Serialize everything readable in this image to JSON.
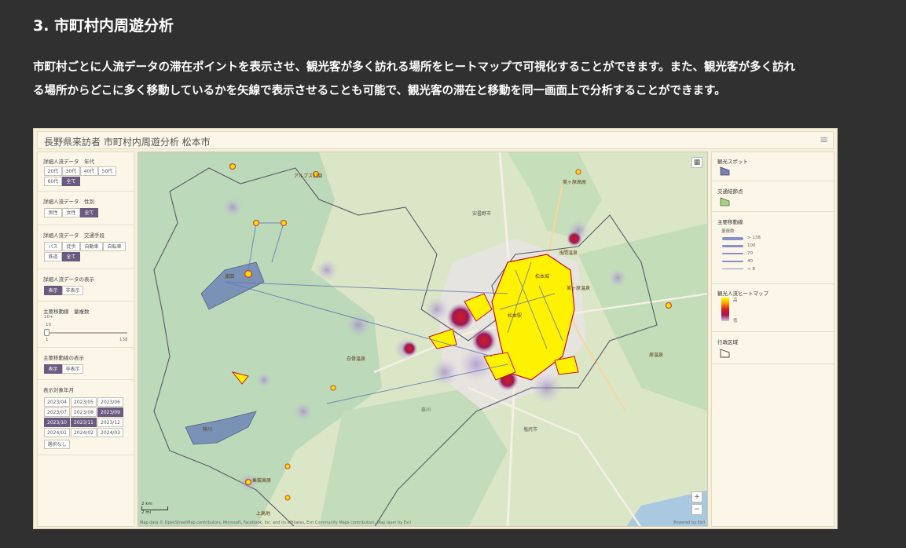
{
  "section": {
    "title": "3. 市町村内周遊分析",
    "desc_line1": "市町村ごとに人流データの滞在ポイントを表示させ、観光客が多く訪れる場所をヒートマップで可視化することができます。また、観光客が多く訪れ",
    "desc_line2": "る場所からどこに多く移動しているかを矢線で表示させることも可能で、観光客の滞在と移動を同一画面上で分析することができます。"
  },
  "app": {
    "title": "長野県来訪者 市町村内周遊分析 松本市",
    "menu_icon": "hamburger-icon"
  },
  "filters": {
    "age": {
      "label": "詳細人流データ　年代",
      "options": [
        "20代",
        "30代",
        "40代",
        "50代",
        "60代",
        "全て"
      ],
      "selected": "全て"
    },
    "gender": {
      "label": "詳細人流データ　性別",
      "options": [
        "男性",
        "女性",
        "全て"
      ],
      "selected": "全て"
    },
    "transport": {
      "label": "詳細人流データ　交通手段",
      "options": [
        "バス",
        "徒歩",
        "自動車",
        "自転車",
        "鉄道",
        "全て"
      ],
      "selected": "全て"
    },
    "detail_display": {
      "label": "詳細人流データの表示",
      "options": [
        "表示",
        "非表示"
      ],
      "selected": "表示"
    },
    "movement_count": {
      "label": "主要移動線　量複数",
      "sublabel": "10+",
      "value": "10",
      "min": "1",
      "max": "138",
      "value_num": 10
    },
    "movement_display": {
      "label": "主要移動線の表示",
      "options": [
        "表示",
        "非表示"
      ],
      "selected": "表示"
    },
    "months": {
      "label": "表示対象年月",
      "options": [
        "2023/04",
        "2023/05",
        "2023/06",
        "2023/07",
        "2023/08",
        "2023/09",
        "2023/10",
        "2023/11",
        "2023/12",
        "2024/01",
        "2024/02",
        "2024/03"
      ],
      "selected": [
        "2023/09",
        "2023/10",
        "2023/11"
      ],
      "clear": "選択なし"
    }
  },
  "legend": {
    "spot": {
      "title": "観光スポット"
    },
    "transit": {
      "title": "交通結節点"
    },
    "movement": {
      "title": "主要移動線",
      "subtitle": "量複数",
      "items": [
        "> 138",
        "100",
        "70",
        "40",
        "< 8"
      ]
    },
    "heatmap": {
      "title": "観光人流ヒートマップ",
      "high": "高",
      "low": "低",
      "colors": [
        "#ffff00",
        "#ff9900",
        "#d81a1a",
        "#9a1a5a",
        "#d9c9ec"
      ]
    },
    "boundary": {
      "title": "行政区域"
    }
  },
  "map": {
    "controls": {
      "basemap_icon": "grid-icon",
      "zoom_in": "+",
      "zoom_out": "−"
    },
    "scale": {
      "km": "2 km",
      "mi": "2 mi"
    },
    "attribution": "Map data © OpenStreetMap contributors, Microsoft, Facebook, Inc. and its affiliates, Esri Community Maps contributors, Map layer by Esri",
    "powered": "Powered by Esri",
    "labels": {
      "l1": "アルプス公園",
      "l2": "上高地",
      "l3": "松本城",
      "l4": "松本駅",
      "l5": "美ヶ原高原",
      "l6": "乗鞍高原",
      "l7": "白骨温泉",
      "l8": "奈川",
      "l9": "塩尻市",
      "l10": "安曇野市",
      "l11": "浅間温泉",
      "l12": "扉温泉",
      "l13": "美ヶ原温泉",
      "l14": "波田",
      "l15": "梓川"
    }
  }
}
